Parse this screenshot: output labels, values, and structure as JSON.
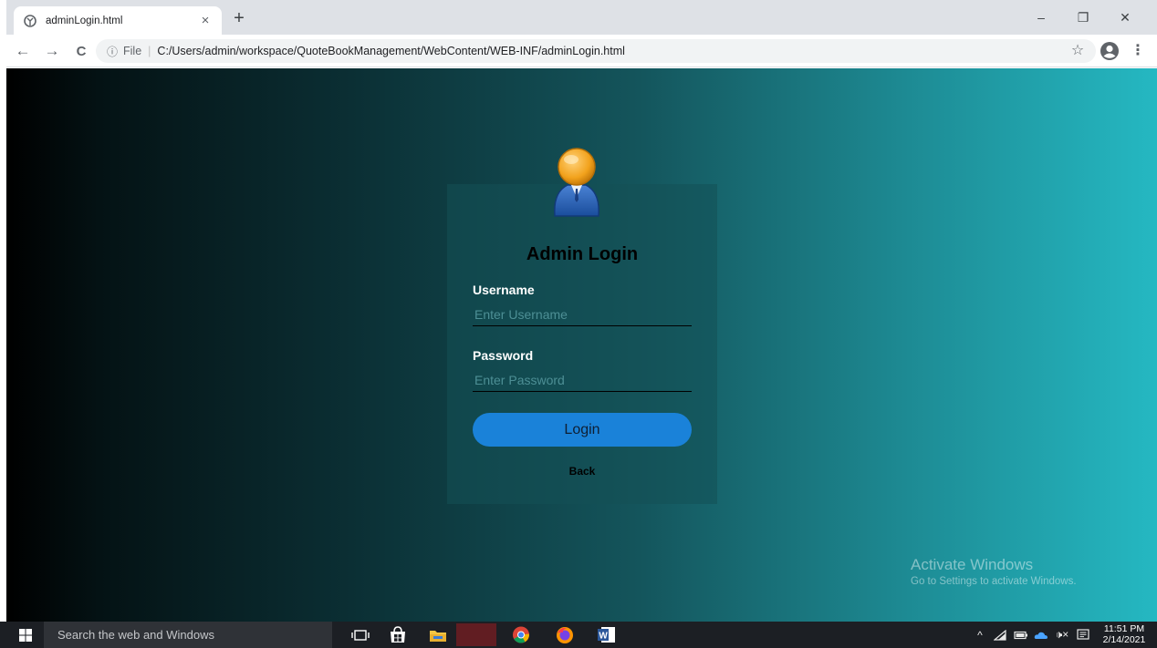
{
  "browser": {
    "tab_title": "adminLogin.html",
    "tab_close": "×",
    "new_tab": "+",
    "url_scheme": "File",
    "url_path": "C:/Users/admin/workspace/QuoteBookManagement/WebContent/WEB-INF/adminLogin.html",
    "info_glyph": "ⓘ",
    "star_glyph": "☆",
    "menu_glyph": "⋮",
    "back_glyph": "←",
    "forward_glyph": "→",
    "reload_glyph": "C",
    "minimize_glyph": "–",
    "maximize_glyph": "❐",
    "close_glyph": "✕"
  },
  "login": {
    "title": "Admin Login",
    "username_label": "Username",
    "username_placeholder": "Enter Username",
    "password_label": "Password",
    "password_placeholder": "Enter Password",
    "login_button": "Login",
    "back_link": "Back"
  },
  "watermark": {
    "line1": "Activate Windows",
    "line2": "Go to Settings to activate Windows."
  },
  "taskbar": {
    "search_placeholder": "Search the web and Windows",
    "time": "11:51 PM",
    "date": "2/14/2021",
    "tray_chevron": "^",
    "volume_glyph": "🕩×"
  },
  "colors": {
    "login_button": "#1a82d9",
    "gradient_start": "#000000",
    "gradient_end": "#25b8c2"
  },
  "icons": [
    "globe-icon",
    "user-avatar-icon",
    "windows-start-icon",
    "task-view-icon",
    "store-icon",
    "file-explorer-icon",
    "chrome-icon",
    "firefox-icon",
    "word-icon",
    "wifi-icon",
    "battery-icon",
    "onedrive-icon",
    "volume-icon",
    "notification-icon"
  ]
}
